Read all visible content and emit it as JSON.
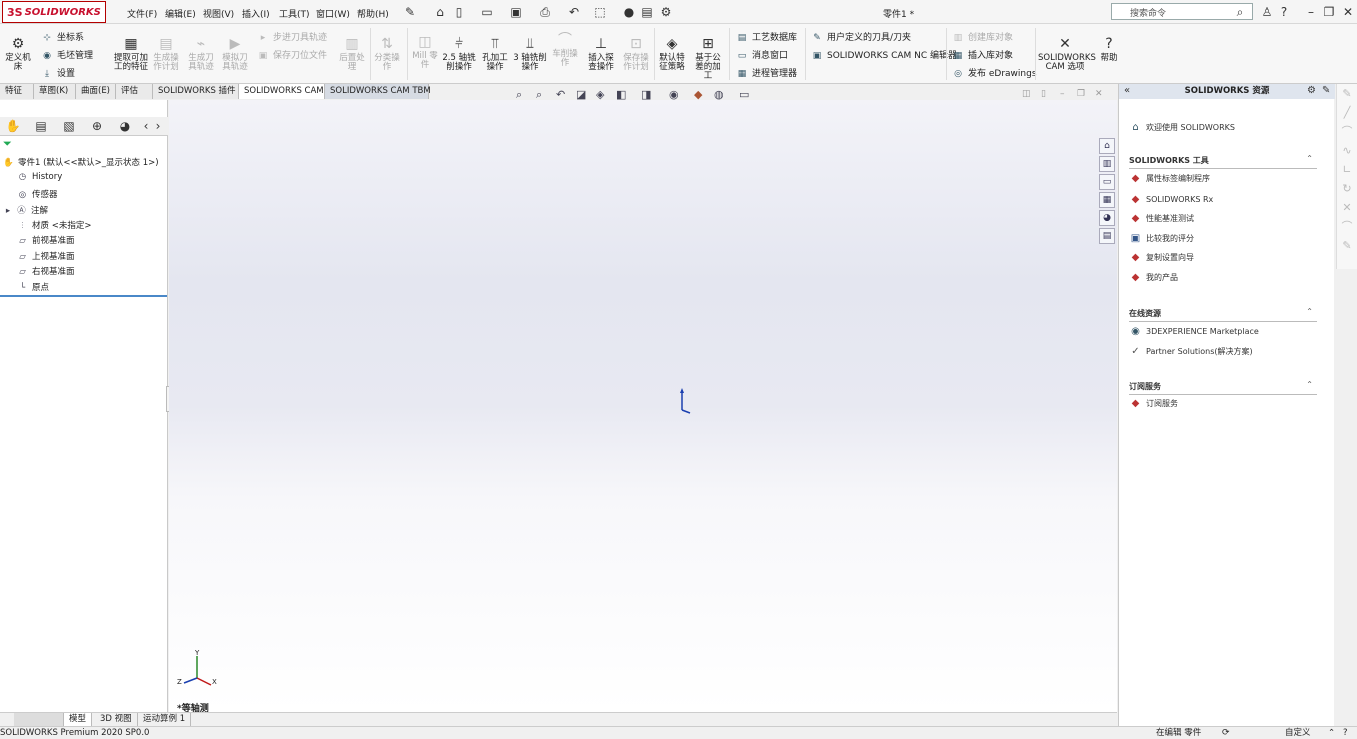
{
  "app": {
    "brand_mark": "3S",
    "brand_name": "SOLIDWORKS",
    "doc_title": "零件1 *"
  },
  "menu": [
    "文件(F)",
    "编辑(E)",
    "视图(V)",
    "插入(I)",
    "工具(T)",
    "窗口(W)",
    "帮助(H)"
  ],
  "search": {
    "placeholder": "搜索命令"
  },
  "ribbon": {
    "define_machine": "定义机床",
    "coord_sys": "坐标系",
    "stock_mgr": "毛坯管理",
    "setup": "设置",
    "extract_features": "提取可加工的特征",
    "gen_op_plan": "生成操作计划",
    "gen_toolpath": "生成刀具轨迹",
    "sim_toolpath": "模拟刀具轨迹",
    "step_toolpath": "步进刀具轨迹",
    "save_cl": "保存刀位文件",
    "post_process": "后置处理",
    "sort_ops": "分类操作",
    "mill_part": "Mill 零件",
    "op_25axis": "2.5 轴铣削操作",
    "hole_op": "孔加工操作",
    "op_3axis": "3 轴铣削操作",
    "turn_op": "车削操作",
    "insert_probe": "插入探查操作",
    "save_op_plan": "保存操作计划",
    "default_strategy": "默认特征策略",
    "tolerance_based": "基于公差的加工",
    "tech_db": "工艺数据库",
    "msg_window": "消息窗口",
    "process_mgr": "进程管理器",
    "user_tool": "用户定义的刀具/刀夹",
    "nc_editor": "SOLIDWORKS CAM NC 编辑器",
    "create_lib": "创建库对象",
    "insert_lib": "插入库对象",
    "publish_edrw": "发布 eDrawings",
    "cam_options": "SOLIDWORKS CAM 选项",
    "help": "帮助"
  },
  "tabs": [
    "特征",
    "草图(K)",
    "曲面(E)",
    "评估",
    "SOLIDWORKS 插件",
    "SOLIDWORKS CAM",
    "SOLIDWORKS CAM TBM"
  ],
  "tree": {
    "root": "零件1 (默认<<默认>_显示状态 1>)",
    "items": [
      "History",
      "传感器",
      "注解",
      "材质 <未指定>",
      "前视基准面",
      "上视基准面",
      "右视基准面",
      "原点"
    ]
  },
  "viewport": {
    "view_label": "*等轴测",
    "axes": [
      "X",
      "Y",
      "Z"
    ]
  },
  "bottom_tabs": [
    "模型",
    "3D 视图",
    "运动算例 1"
  ],
  "status": {
    "product": "SOLIDWORKS Premium 2020 SP0.0",
    "editing": "在编辑 零件",
    "custom": "自定义"
  },
  "resources": {
    "title": "SOLIDWORKS 资源",
    "welcome": "欢迎使用 SOLIDWORKS",
    "tools_section": "SOLIDWORKS 工具",
    "tools": [
      "属性标签编制程序",
      "SOLIDWORKS Rx",
      "性能基准测试",
      "比较我的评分",
      "复制设置向导",
      "我的产品"
    ],
    "online_section": "在线资源",
    "online": [
      "3DEXPERIENCE Marketplace",
      "Partner Solutions(解决方案)"
    ],
    "sub_section": "订阅服务",
    "sub": [
      "订阅服务"
    ]
  }
}
